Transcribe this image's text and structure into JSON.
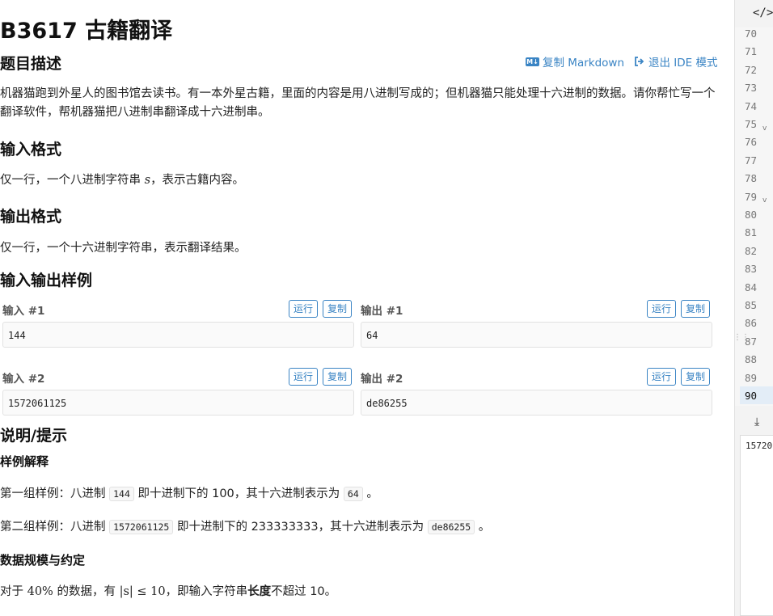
{
  "problem": {
    "title": "B3617 古籍翻译",
    "copy_markdown": "复制 Markdown",
    "exit_ide": "退出 IDE 模式",
    "description_heading": "题目描述",
    "description": "机器猫跑到外星人的图书馆去读书。有一本外星古籍，里面的内容是用八进制写成的；但机器猫只能处理十六进制的数据。请你帮忙写一个翻译软件，帮机器猫把八进制串翻译成十六进制串。",
    "input_heading": "输入格式",
    "input_pre": "仅一行，一个八进制字符串 ",
    "input_var": "s",
    "input_post": "，表示古籍内容。",
    "output_heading": "输出格式",
    "output_text": "仅一行，一个十六进制字符串，表示翻译结果。",
    "samples_heading": "输入输出样例",
    "run_label": "运行",
    "copy_label": "复制",
    "samples": [
      {
        "in_label": "输入 #1",
        "out_label": "输出 #1",
        "input": "144",
        "output": "64"
      },
      {
        "in_label": "输入 #2",
        "out_label": "输出 #2",
        "input": "1572061125",
        "output": "de86255"
      }
    ],
    "hint_heading": "说明/提示",
    "explain_heading": "样例解释",
    "explain1": {
      "a": "第一组样例：八进制 ",
      "code1": "144",
      "b": " 即十进制下的 100，其十六进制表示为 ",
      "code2": "64",
      "c": " 。"
    },
    "explain2": {
      "a": "第二组样例：八进制 ",
      "code1": "1572061125",
      "b": " 即十进制下的 233333333，其十六进制表示为 ",
      "code2": "de86255",
      "c": " 。"
    },
    "constraints_heading": "数据规模与约定",
    "constraint": {
      "a": "对于 ",
      "pct": "40%",
      "b": " 的数据，有 ",
      "math": "|s| ≤ 10",
      "c": "，即输入字符串",
      "bold": "长度",
      "d": "不超过 10。"
    }
  },
  "ide": {
    "code_toggle": "</>",
    "line_numbers": [
      "70",
      "71",
      "72",
      "73",
      "74",
      "75",
      "76",
      "77",
      "78",
      "79",
      "80",
      "81",
      "82",
      "83",
      "84",
      "85",
      "86",
      "87",
      "88",
      "89",
      "90"
    ],
    "active_line": "90",
    "input_value": "15720"
  },
  "colors": {
    "accent": "#3a84c4"
  }
}
